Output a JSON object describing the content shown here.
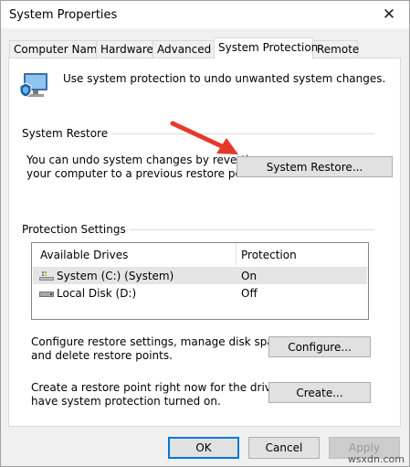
{
  "window": {
    "title": "System Properties",
    "close_glyph": "✕"
  },
  "tabs": [
    {
      "label": "Computer Name"
    },
    {
      "label": "Hardware"
    },
    {
      "label": "Advanced"
    },
    {
      "label": "System Protection"
    },
    {
      "label": "Remote"
    }
  ],
  "intro": {
    "text": "Use system protection to undo unwanted system changes."
  },
  "system_restore": {
    "section_label": "System Restore",
    "description_line1": "You can undo system changes by reverting",
    "description_line2": "your computer to a previous restore point.",
    "button_label": "System Restore..."
  },
  "protection_settings": {
    "section_label": "Protection Settings",
    "columns": [
      "Available Drives",
      "Protection"
    ],
    "drives": [
      {
        "name": "System (C:) (System)",
        "protection": "On",
        "icon": "system-drive-icon"
      },
      {
        "name": "Local Disk (D:)",
        "protection": "Off",
        "icon": "disk-drive-icon"
      }
    ],
    "configure_text_line1": "Configure restore settings, manage disk space,",
    "configure_text_line2": "and delete restore points.",
    "configure_button": "Configure...",
    "create_text_line1": "Create a restore point right now for the drives that",
    "create_text_line2": "have system protection turned on.",
    "create_button": "Create..."
  },
  "footer": {
    "ok": "OK",
    "cancel": "Cancel",
    "apply": "Apply"
  },
  "watermark": "wsxdn.com",
  "colors": {
    "arrow": "#e53a2a",
    "primary_border": "#0078d7"
  }
}
